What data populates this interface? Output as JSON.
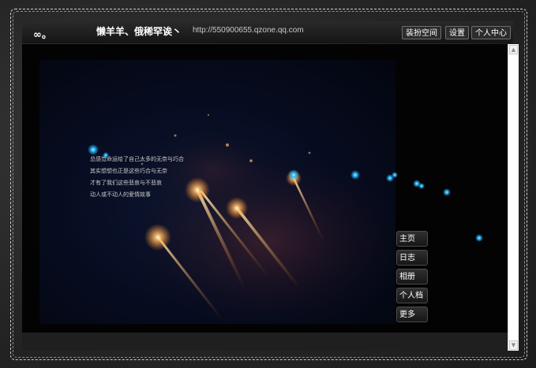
{
  "header": {
    "logo": "∞。",
    "space_name": "懒羊羊、俄稀罕诶丶",
    "space_url": "http://550900655.qzone.qq.com",
    "buttons": [
      "装扮空间",
      "设置",
      "个人中心"
    ]
  },
  "photo": {
    "poem_lines": [
      "总感觉命运给了自己太多的无奈与巧合",
      "其实想想也正是这些巧合与无奈",
      "才有了我们这些悲哀与不悲哀",
      "动人或不动人的爱情故事"
    ]
  },
  "nav": {
    "items": [
      "主页",
      "日志",
      "相册",
      "个人档",
      "更多"
    ]
  },
  "colors": {
    "accent_dot": "#1fb6ff",
    "main_bg": "#030303",
    "photo_bg": "#070d22"
  }
}
